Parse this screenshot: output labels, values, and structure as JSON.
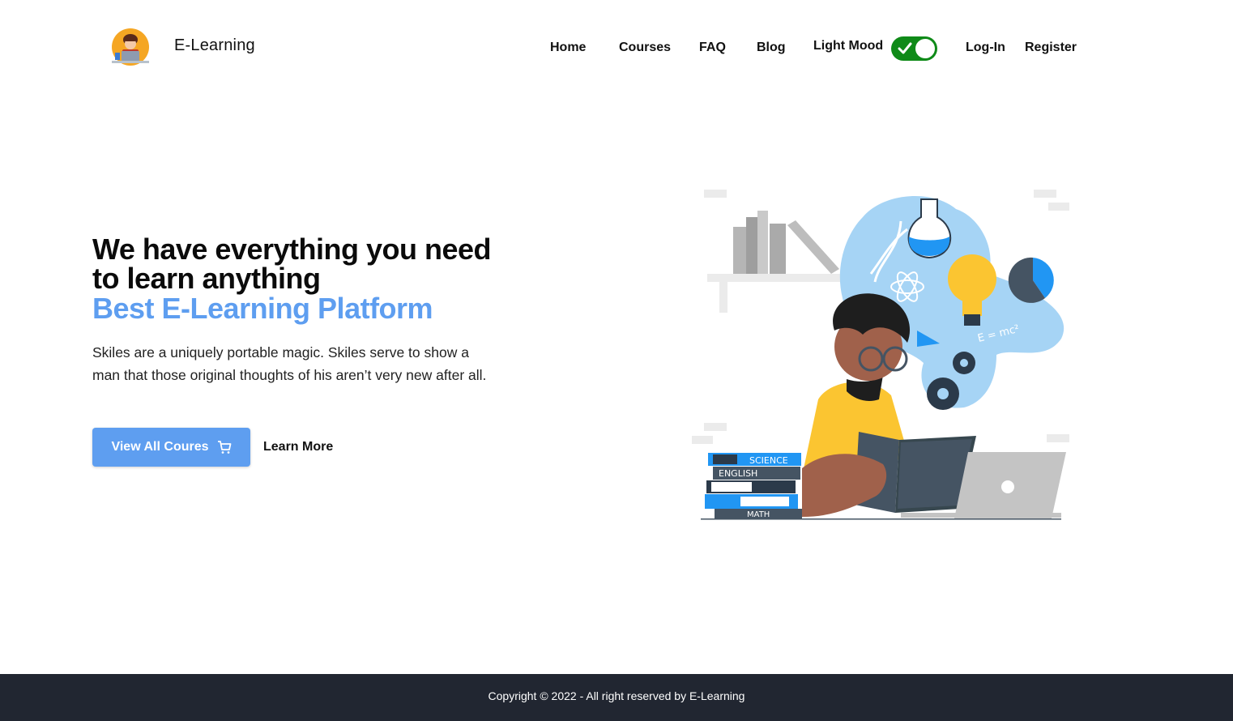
{
  "brand": {
    "name": "E-Learning"
  },
  "nav": {
    "items": [
      {
        "label": "Home"
      },
      {
        "label": "Courses"
      },
      {
        "label": "FAQ"
      },
      {
        "label": "Blog"
      }
    ],
    "mood_label": "Light Mood",
    "mood_toggle_on": true,
    "login_label": "Log-In",
    "register_label": "Register"
  },
  "hero": {
    "title": "We have everything you need to learn anything",
    "accent": "Best E-Learning Platform",
    "description": "Skiles are a uniquely portable magic. Skiles serve to show a man that those original thoughts of his aren’t very new after all.",
    "primary_button": "View All Coures",
    "secondary_button": "Learn More",
    "illustration": {
      "book_labels": [
        "SCIENCE",
        "ENGLISH",
        "MATH"
      ],
      "formula": "E = mc²"
    }
  },
  "footer": {
    "copyright": "Copyright © 2022 - All right reserved by E-Learning"
  },
  "colors": {
    "accent": "#5e9ef0",
    "toggle": "#0f8a18",
    "footer_bg": "#212631"
  },
  "icons": {
    "cart": "cart-icon",
    "check": "check-icon"
  }
}
